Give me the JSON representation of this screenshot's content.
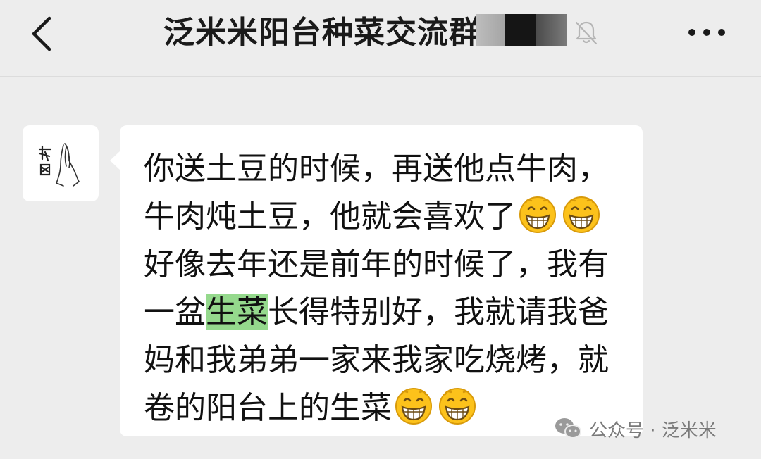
{
  "header": {
    "back_icon": "chevron-left-icon",
    "title": "泛米米阳台种菜交流群",
    "mute_icon": "bell-muted-icon",
    "more_icon": "more-dots-icon"
  },
  "message": {
    "sender_avatar": "praying-hands-avatar",
    "lines": {
      "l1": "你送土豆的时候，再送他点牛肉，",
      "l2": "牛肉炖土豆，他就会喜欢了",
      "l3": "好像去年还是前年的时候了，我有",
      "l4a": "一盆",
      "l4hl": "生菜",
      "l4b": "长得特别好，我就请我爸",
      "l5": "妈和我弟弟一家来我家吃烧烤，就",
      "l6": "卷的阳台上的生菜"
    },
    "emoji": "grinning-face-emoji",
    "highlight_color": "#95d98d"
  },
  "watermark": {
    "text": "公众号 · 泛米米",
    "icon": "wechat-official-account-icon"
  },
  "colors": {
    "background": "#ededed",
    "bubble": "#ffffff",
    "text": "#111111"
  }
}
